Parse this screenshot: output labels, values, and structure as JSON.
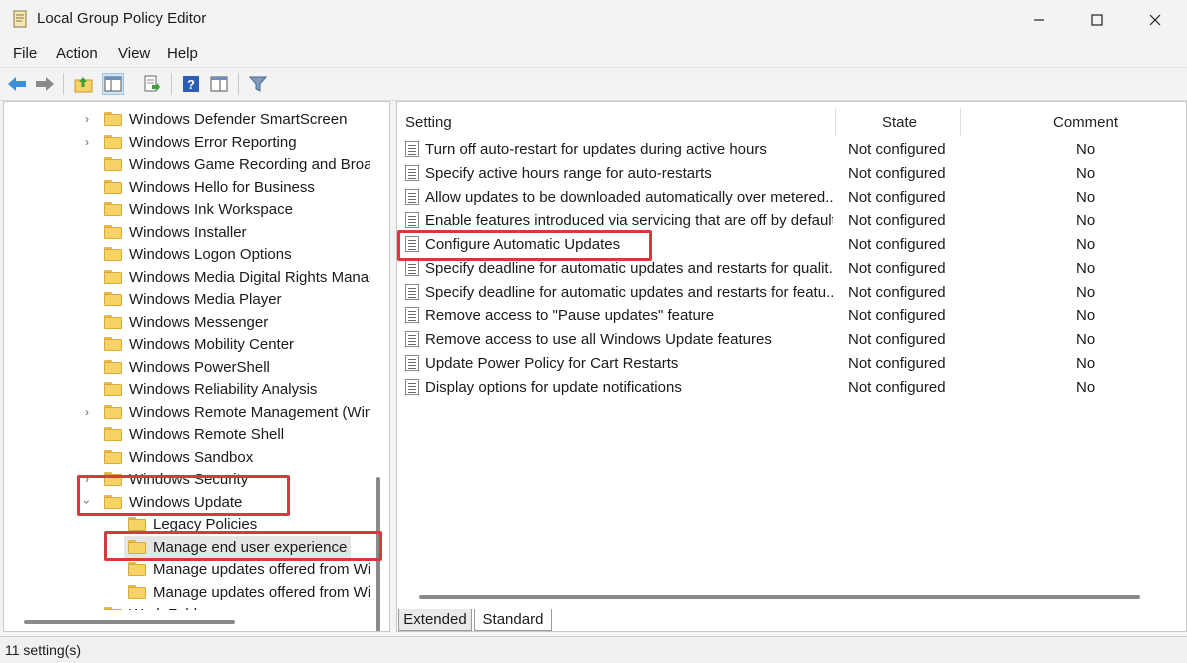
{
  "window": {
    "title": "Local Group Policy Editor"
  },
  "menu": [
    "File",
    "Action",
    "View",
    "Help"
  ],
  "toolbar": {
    "buttons": [
      "back-icon",
      "forward-icon",
      "up-folder-icon",
      "show-hide-tree-icon",
      "export-list-icon",
      "help-icon",
      "properties-icon",
      "filter-icon"
    ]
  },
  "tree": {
    "items": [
      {
        "label": "Windows Defender SmartScreen",
        "expandable": true
      },
      {
        "label": "Windows Error Reporting",
        "expandable": true
      },
      {
        "label": "Windows Game Recording and Broadcasting",
        "expandable": false
      },
      {
        "label": "Windows Hello for Business",
        "expandable": false
      },
      {
        "label": "Windows Ink Workspace",
        "expandable": false
      },
      {
        "label": "Windows Installer",
        "expandable": false
      },
      {
        "label": "Windows Logon Options",
        "expandable": false
      },
      {
        "label": "Windows Media Digital Rights Management",
        "expandable": false
      },
      {
        "label": "Windows Media Player",
        "expandable": false
      },
      {
        "label": "Windows Messenger",
        "expandable": false
      },
      {
        "label": "Windows Mobility Center",
        "expandable": false
      },
      {
        "label": "Windows PowerShell",
        "expandable": false
      },
      {
        "label": "Windows Reliability Analysis",
        "expandable": false
      },
      {
        "label": "Windows Remote Management (WinRM)",
        "expandable": true
      },
      {
        "label": "Windows Remote Shell",
        "expandable": false
      },
      {
        "label": "Windows Sandbox",
        "expandable": false
      },
      {
        "label": "Windows Security",
        "expandable": true
      },
      {
        "label": "Windows Update",
        "expandable": true,
        "expanded": true
      },
      {
        "label": "Legacy Policies",
        "child": true
      },
      {
        "label": "Manage end user experience",
        "child": true,
        "selected": true
      },
      {
        "label": "Manage updates offered from Windows Server Update Service",
        "child": true
      },
      {
        "label": "Manage updates offered from Windows Update",
        "child": true
      },
      {
        "label": "Work Folders",
        "expandable": false
      }
    ]
  },
  "list": {
    "headers": {
      "setting": "Setting",
      "state": "State",
      "comment": "Comment"
    },
    "rows": [
      {
        "setting": "Turn off auto-restart for updates during active hours",
        "state": "Not configured",
        "comment": "No"
      },
      {
        "setting": "Specify active hours range for auto-restarts",
        "state": "Not configured",
        "comment": "No"
      },
      {
        "setting": "Allow updates to be downloaded automatically over metered...",
        "state": "Not configured",
        "comment": "No"
      },
      {
        "setting": "Enable features introduced via servicing that are off by default",
        "state": "Not configured",
        "comment": "No"
      },
      {
        "setting": "Configure Automatic Updates",
        "state": "Not configured",
        "comment": "No"
      },
      {
        "setting": "Specify deadline for automatic updates and restarts for qualit...",
        "state": "Not configured",
        "comment": "No"
      },
      {
        "setting": "Specify deadline for automatic updates and restarts for featu...",
        "state": "Not configured",
        "comment": "No"
      },
      {
        "setting": "Remove access to \"Pause updates\" feature",
        "state": "Not configured",
        "comment": "No"
      },
      {
        "setting": "Remove access to use all Windows Update features",
        "state": "Not configured",
        "comment": "No"
      },
      {
        "setting": "Update Power Policy for Cart Restarts",
        "state": "Not configured",
        "comment": "No"
      },
      {
        "setting": "Display options for update notifications",
        "state": "Not configured",
        "comment": "No"
      }
    ]
  },
  "tabs": [
    "Extended",
    "Standard"
  ],
  "status": "11 setting(s)",
  "colors": {
    "highlight": "#d9393e",
    "folder": "#f7d266",
    "arrow": "#3b8ed8"
  }
}
